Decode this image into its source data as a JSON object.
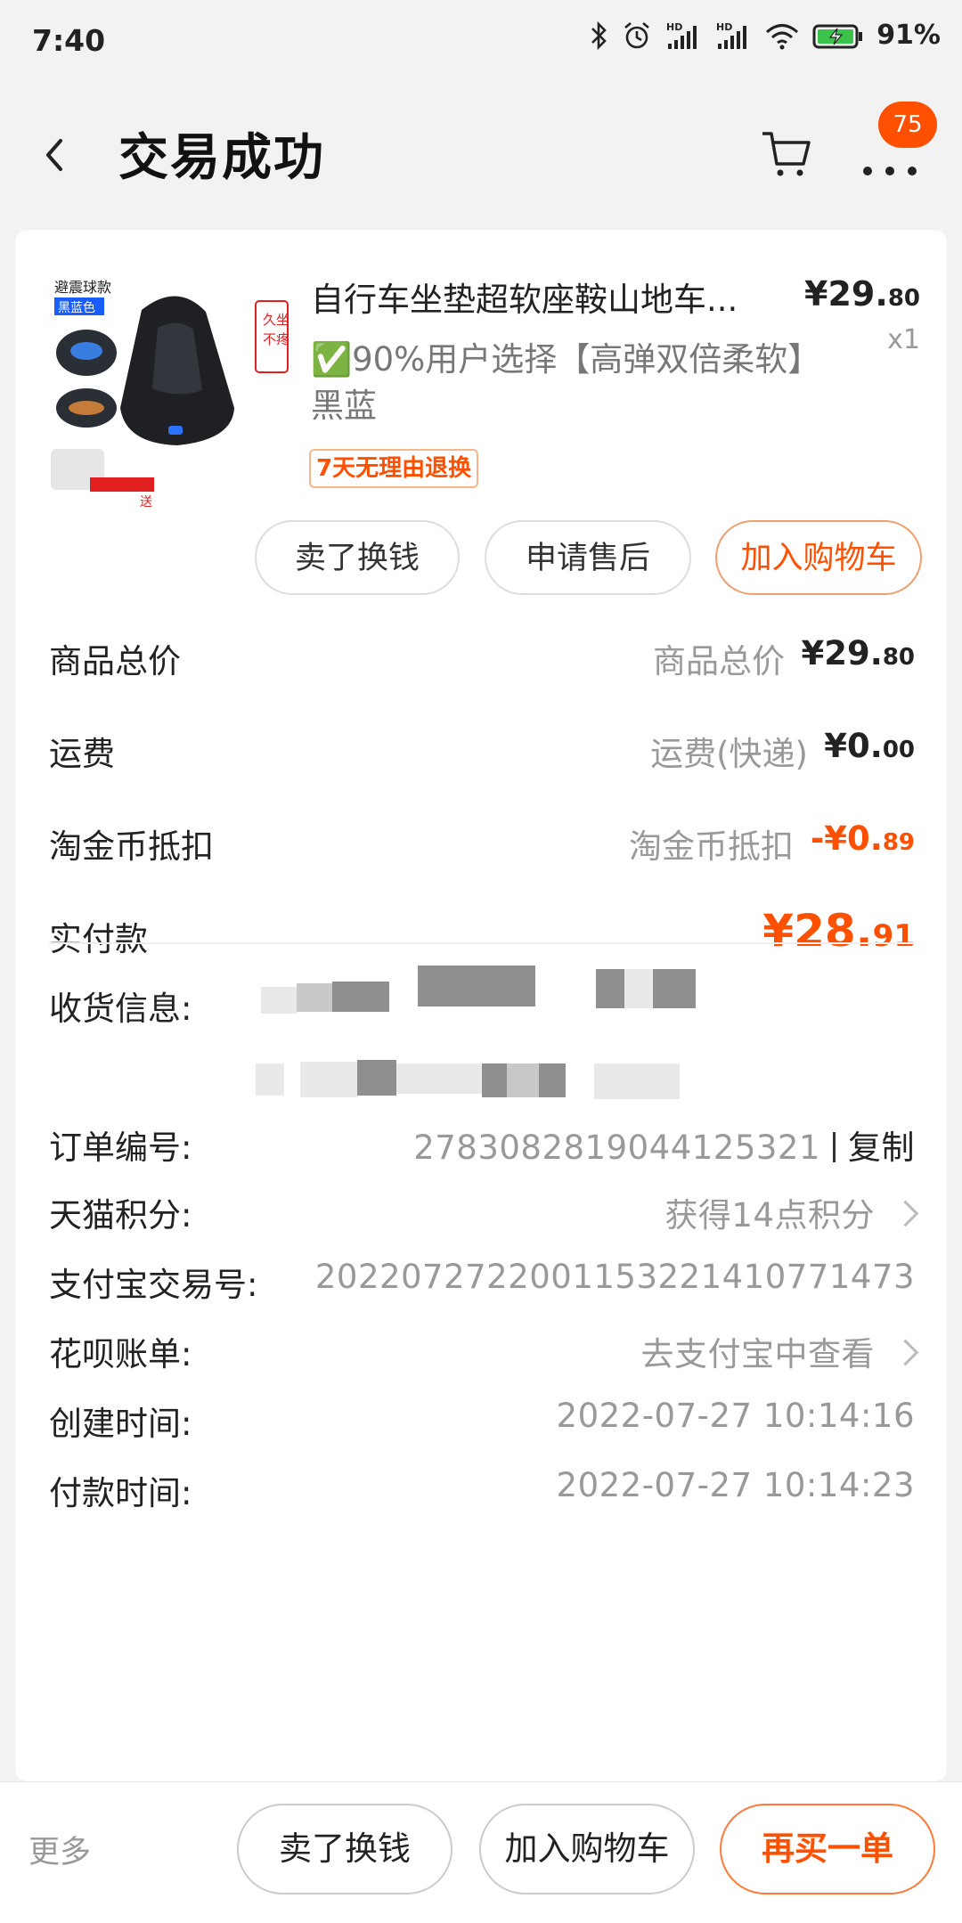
{
  "status_bar": {
    "time": "7:40",
    "battery": "91%",
    "icons": [
      "bluetooth-icon",
      "alarm-icon",
      "signal-hd-icon",
      "signal-hd-icon",
      "wifi-icon",
      "battery-charging-icon"
    ]
  },
  "nav": {
    "title": "交易成功",
    "badge_count": "75",
    "icons": [
      "back-arrow-icon",
      "cart-icon",
      "more-dots-icon"
    ]
  },
  "product": {
    "image_label": "product-image",
    "title": "自行车坐垫超软座鞍山地车...",
    "sku": "✅90%用户选择【高弹双倍柔软】黑蓝",
    "tag": "7天无理由退换",
    "price_main": "¥29.",
    "price_decimal": "80",
    "quantity": "x1",
    "actions": [
      "卖了换钱",
      "申请售后",
      "加入购物车"
    ]
  },
  "summary": {
    "goods_total_label": "商品总价",
    "goods_total_mid": "商品总价",
    "goods_total_main": "¥29.",
    "goods_total_decimal": "80",
    "shipping_label": "运费",
    "shipping_mid": "运费(快递)",
    "shipping_main": "¥0.",
    "shipping_decimal": "00",
    "coin_label": "淘金币抵扣",
    "coin_mid": "淘金币抵扣",
    "coin_main": "-¥0.",
    "coin_decimal": "89",
    "paid_label": "实付款",
    "paid_main": "¥28.",
    "paid_decimal": "91"
  },
  "details": {
    "address_label": "收货信息:",
    "order_label": "订单编号:",
    "order_value": "2783082819044125321",
    "copy_label": "复制",
    "points_label": "天猫积分:",
    "points_value": "获得14点积分",
    "alipay_label": "支付宝交易号:",
    "alipay_value": "2022072722001153221410771473",
    "huabei_label": "花呗账单:",
    "huabei_value": "去支付宝中查看",
    "created_label": "创建时间:",
    "created_value": "2022-07-27 10:14:16",
    "paid_time_label": "付款时间:",
    "paid_time_value": "2022-07-27 10:14:23"
  },
  "bottom": {
    "more": "更多",
    "sell": "卖了换钱",
    "add_cart": "加入购物车",
    "rebuy": "再买一单"
  },
  "colors": {
    "accent": "#ff5000",
    "badge": "#ff5000",
    "background": "#f2f2f2"
  }
}
